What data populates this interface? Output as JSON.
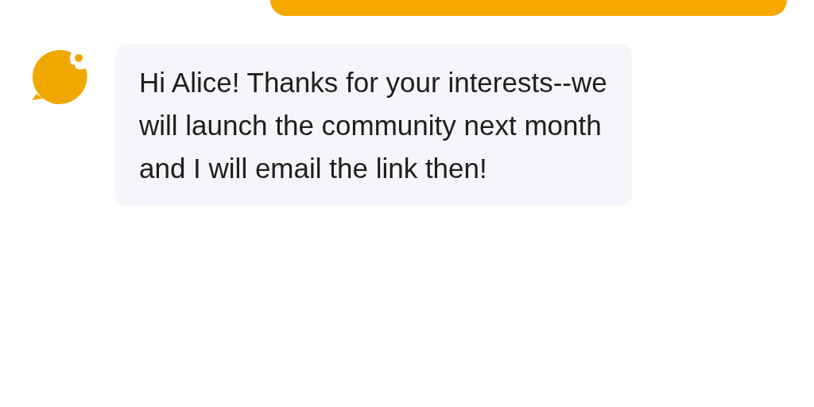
{
  "messages": [
    {
      "kind": "outgoing"
    },
    {
      "kind": "incoming",
      "text": "Hi Alice! Thanks for your interests--we will launch the community next month and I will email the link then!"
    }
  ]
}
